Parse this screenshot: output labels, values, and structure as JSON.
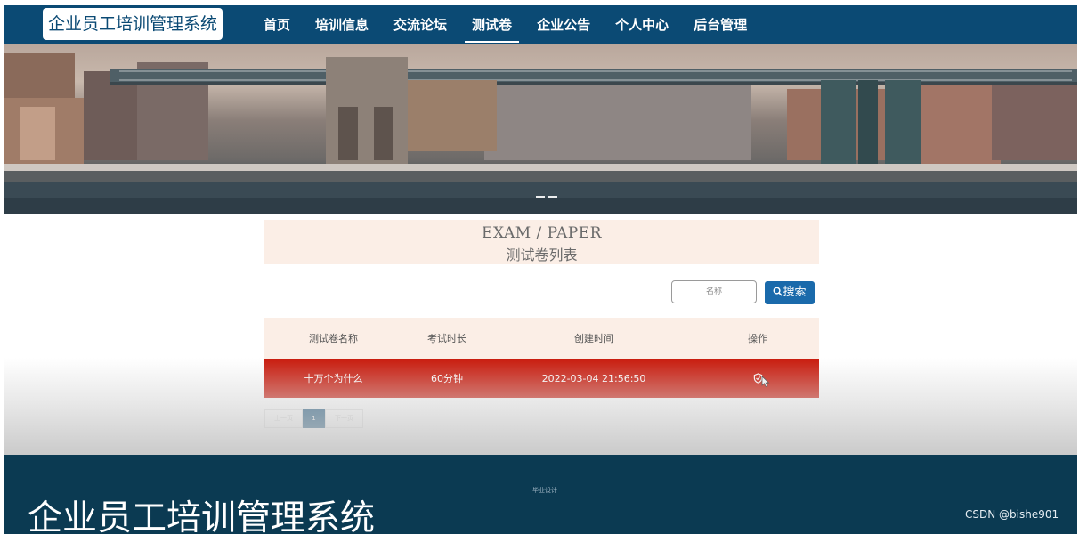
{
  "app": {
    "logo_text": "企业员工培训管理系统"
  },
  "nav": {
    "items": [
      {
        "label": "首页",
        "active": false
      },
      {
        "label": "培训信息",
        "active": false
      },
      {
        "label": "交流论坛",
        "active": false
      },
      {
        "label": "测试卷",
        "active": true
      },
      {
        "label": "企业公告",
        "active": false
      },
      {
        "label": "个人中心",
        "active": false
      },
      {
        "label": "后台管理",
        "active": false
      }
    ]
  },
  "page_header": {
    "english": "EXAM / PAPER",
    "chinese": "测试卷列表"
  },
  "search": {
    "placeholder": "名称",
    "button_label": "搜索",
    "icon": "search-icon"
  },
  "table": {
    "headers": [
      "测试卷名称",
      "考试时长",
      "创建时间",
      "操作"
    ],
    "rows": [
      {
        "name": "十万个为什么",
        "duration": "60分钟",
        "created": "2022-03-04 21:56:50",
        "action_icon": "shield-check-icon"
      }
    ]
  },
  "pagination": {
    "prev_label": "上一页",
    "current_page": "1",
    "next_label": "下一页"
  },
  "footer": {
    "note": "毕业设计",
    "title": "企业员工培训管理系统"
  },
  "watermark": "CSDN @bishe901",
  "colors": {
    "nav_bg": "#0b4a74",
    "accent_blue": "#1a6aab",
    "row_highlight": "#c91a0c",
    "header_bg": "#fbeee6",
    "footer_bg": "#0b3a52"
  }
}
